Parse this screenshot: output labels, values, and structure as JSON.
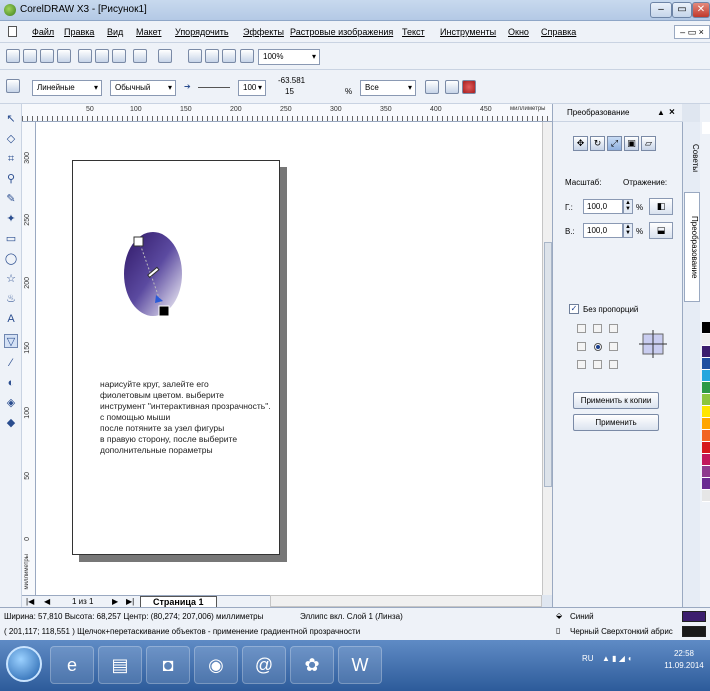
{
  "window": {
    "title": "CorelDRAW X3 - [Рисунок1]",
    "min": "–",
    "max": "▭",
    "close": "✕"
  },
  "menu": {
    "items": [
      "Файл",
      "Правка",
      "Вид",
      "Макет",
      "Упорядочить",
      "Эффекты",
      "Растровые изображения",
      "Текст",
      "Инструменты",
      "Окно",
      "Справка"
    ],
    "mdi_controls": "– ▭ ×"
  },
  "toolbar1": {
    "zoom": "100%"
  },
  "toolbar2": {
    "linear_type": "Линейные",
    "mode": "Обычный",
    "value": "100",
    "coord_x": "-63.581",
    "coord_y": "15",
    "percent": "%",
    "target": "Все"
  },
  "ruler": {
    "unit": "миллиметры",
    "top_ticks": [
      "50",
      "100",
      "150",
      "200",
      "250",
      "300",
      "350",
      "400",
      "450"
    ],
    "left_ticks": [
      "300",
      "250",
      "200",
      "150",
      "100",
      "50",
      "0"
    ],
    "left_unit": "миллиметры"
  },
  "canvas": {
    "instruction_lines": [
      "нарисуйте круг, залейте его",
      "фиолетовым цветом. выберите",
      "инструмент \"интерактивная прозрачность\".",
      "с помощью мыши",
      "после потяните за узел фигуры",
      "в правую сторону, после выберите",
      "дополнительные пораметры"
    ]
  },
  "pagenav": {
    "position": "1 из 1",
    "page_tab": "Страница 1"
  },
  "docker": {
    "title": "Преобразование",
    "scale_label": "Масштаб:",
    "mirror_label": "Отражение:",
    "h_label": "Г.:",
    "h_value": "100,0",
    "v_label": "В.:",
    "v_value": "100,0",
    "percent": "%",
    "proportional_label": "Без пропорций",
    "apply_copy": "Применить к копии",
    "apply": "Применить"
  },
  "vtabs": {
    "tips": "Советы",
    "transform": "Преобразование"
  },
  "palette": {
    "colors": [
      "#ffffff",
      "#000000",
      "#f0f0f0",
      "#3c1e6e",
      "#1f4fa0",
      "#26a7de",
      "#2e9a46",
      "#8dc63f",
      "#ffe600",
      "#ffa500",
      "#f26522",
      "#d7191c",
      "#c2185b",
      "#8e3b8e",
      "#6a2c91",
      "#e6e6e6"
    ]
  },
  "status": {
    "line1": "Ширина: 57,810 Высота: 68,257 Центр: (80,274; 207,006) миллиметры",
    "object": "Эллипс вкл. Слой 1 (Линза)",
    "line2": "( 201,117; 118,551 )   Щелчок+перетаскивание объектов - применение градиентной прозрачности",
    "fill_name": "Синий",
    "fill_color": "#3c1e6e",
    "outline_name": "Черный  Сверхтонкий абрис",
    "outline_color": "#1a1a1a"
  },
  "taskbar": {
    "lang": "RU",
    "time": "22:58",
    "date": "11.09.2014"
  }
}
